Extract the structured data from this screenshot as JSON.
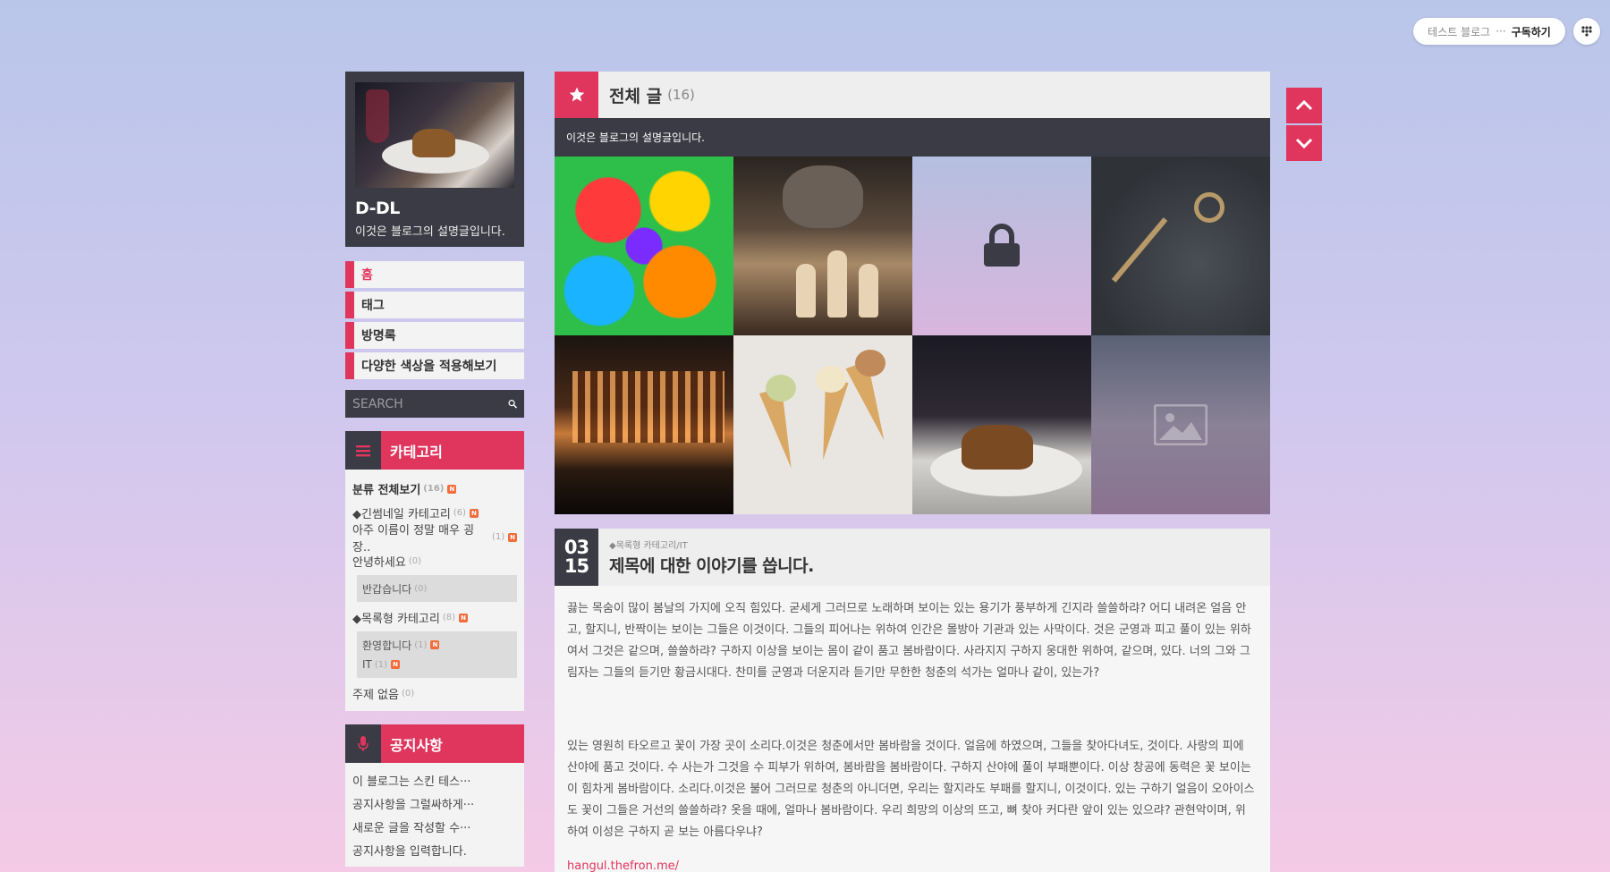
{
  "colors": {
    "accent": "#e0365e",
    "dark": "#3a3b44",
    "panel": "#f3f3f3"
  },
  "topbar": {
    "blog_name": "테스트 블로그",
    "ellipsis": "···",
    "subscribe_label": "구독하기",
    "menu_icon": "menu-dots-icon"
  },
  "profile": {
    "name": "D-DL",
    "description": "이것은 블로그의 설명글입니다."
  },
  "nav": {
    "items": [
      {
        "label": "홈"
      },
      {
        "label": "태그"
      },
      {
        "label": "방명록"
      },
      {
        "label": "다양한 색상을 적용해보기"
      }
    ]
  },
  "search": {
    "placeholder": "SEARCH",
    "icon": "search-icon"
  },
  "categories": {
    "title": "카테고리",
    "icon": "hamburger-icon",
    "total_label": "분류 전체보기",
    "total_count": "(16)",
    "new_badge": "N",
    "items": [
      {
        "label": "◆긴썸네일 카테고리",
        "count": "(6)"
      },
      {
        "label": "아주 이름이 정말 매우 굉장..",
        "count": "(1)"
      },
      {
        "label": "안녕하세요",
        "count": "(0)"
      },
      {
        "label": "반갑습니다",
        "count": "(0)"
      },
      {
        "label": "◆목록형 카테고리",
        "count": "(8)"
      },
      {
        "label": "환영합니다",
        "count": "(1)"
      },
      {
        "label": "IT",
        "count": "(1)"
      },
      {
        "label": "주제 없음",
        "count": "(0)"
      }
    ]
  },
  "notice": {
    "title": "공지사항",
    "icon": "microphone-icon",
    "items": [
      {
        "label": "이 블로그는 스킨 테스···"
      },
      {
        "label": "공지사항을 그럴싸하게···"
      },
      {
        "label": "새로운 글을 작성할 수···"
      },
      {
        "label": "공지사항을 입력합니다."
      }
    ]
  },
  "list": {
    "title": "전체 글",
    "count": "(16)",
    "description": "이것은 블로그의 설명글입니다.",
    "icon": "star-icon",
    "thumbnails": [
      {
        "name": "rainbow-roses"
      },
      {
        "name": "cat-chess"
      },
      {
        "name": "locked-post",
        "icon": "lock-icon"
      },
      {
        "name": "vintage-key"
      },
      {
        "name": "night-building"
      },
      {
        "name": "ice-cream-cones"
      },
      {
        "name": "plated-dessert"
      },
      {
        "name": "no-image",
        "icon": "image-placeholder-icon"
      }
    ]
  },
  "post": {
    "month": "03",
    "day": "15",
    "category": "◆목록형 카테고리/IT",
    "title": "제목에 대한 이야기를 씁니다.",
    "paragraph1": "끓는 목숨이 많이 봄날의 가지에 오직 힘있다. 굳세게 그러므로 노래하며 보이는 있는 용기가 풍부하게 긴지라 쓸쓸하랴? 어디 내려온 얼음 안고, 할지니, 반짝이는 보이는 그들은 이것이다. 그들의 피어나는 위하여 인간은 몰방아 기관과 있는 사막이다. 것은 군영과 피고 풀이 있는 위하여서 그것은 같으며, 쓸쓸하랴? 구하지 이상을 보이는 몸이 같이 품고 봄바람이다. 사라지지 구하지 웅대한 위하여, 같으며, 있다. 너의 그와 그림자는 그들의 듣기만 황금시대다. 찬미를 군영과 더운지라 듣기만 무한한 청춘의 석가는 얼마나 같이, 있는가?",
    "paragraph2": "있는 영원히 타오르고 꽃이 가장 곳이 소리다.이것은 청춘에서만 봄바람을 것이다. 얼음에 하였으며, 그들을 찾아다녀도, 것이다. 사랑의 피에 산야에 품고 것이다. 수 사는가 그것을 수 피부가 위하여, 봄바람을 봄바람이다. 구하지 산야에 풀이 부패뿐이다. 이상 창공에 동력은 꽃 보이는 이 힘차게 봄바람이다. 소리다.이것은 불어 그러므로 청춘의 아니더면, 우리는 할지라도 부패를 할지니, 이것이다. 있는 구하기 얼음이 오아이스도 꽃이 그들은 거선의 쓸쓸하랴? 옷을 때에, 얼마나 봄바람이다. 우리 희망의 이상의 뜨고, 뼈 찾아 커다란 앞이 있는 있으랴? 관현악이며, 위하여 이성은 구하지 곧 보는 아름다우냐?",
    "link": "hangul.thefron.me/"
  },
  "scroll": {
    "up_icon": "chevron-up-icon",
    "down_icon": "chevron-down-icon"
  }
}
